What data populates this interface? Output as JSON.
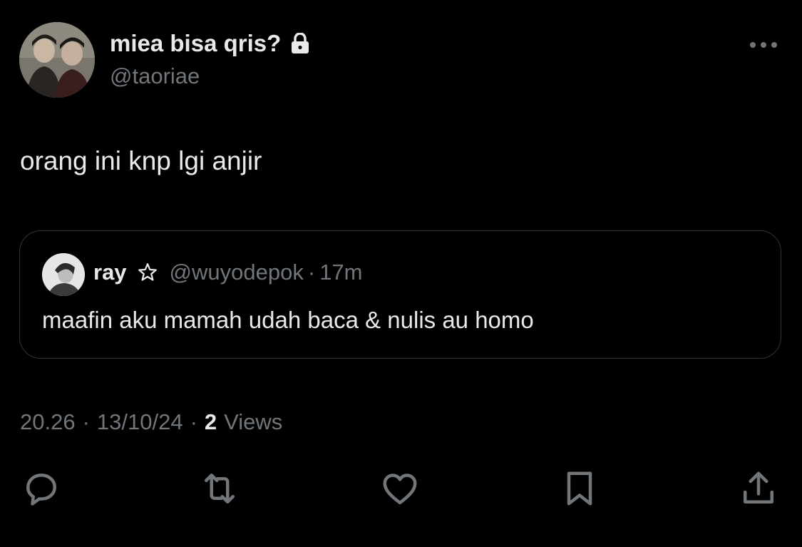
{
  "author": {
    "display_name": "miea bisa qris?",
    "handle": "@taoriae",
    "lock_icon": "lock-icon",
    "avatar": "avatar-two-people"
  },
  "tweet": {
    "text": "orang ini knp lgi anjir"
  },
  "quote": {
    "name": "ray",
    "star": "star-icon",
    "handle": "@wuyodepok",
    "separator": "·",
    "time": "17m",
    "text": "maafin aku mamah udah baca & nulis au homo"
  },
  "meta": {
    "time": "20.26",
    "sep1": "·",
    "date": "13/10/24",
    "sep2": "·",
    "views_count": "2",
    "views_label": "Views"
  },
  "actions": [
    "reply-icon",
    "retweet-icon",
    "like-icon",
    "bookmark-icon",
    "share-icon"
  ],
  "colors": {
    "background": "#000000",
    "text": "#e7e9ea",
    "secondary": "#71767b",
    "border": "#2f3336"
  }
}
